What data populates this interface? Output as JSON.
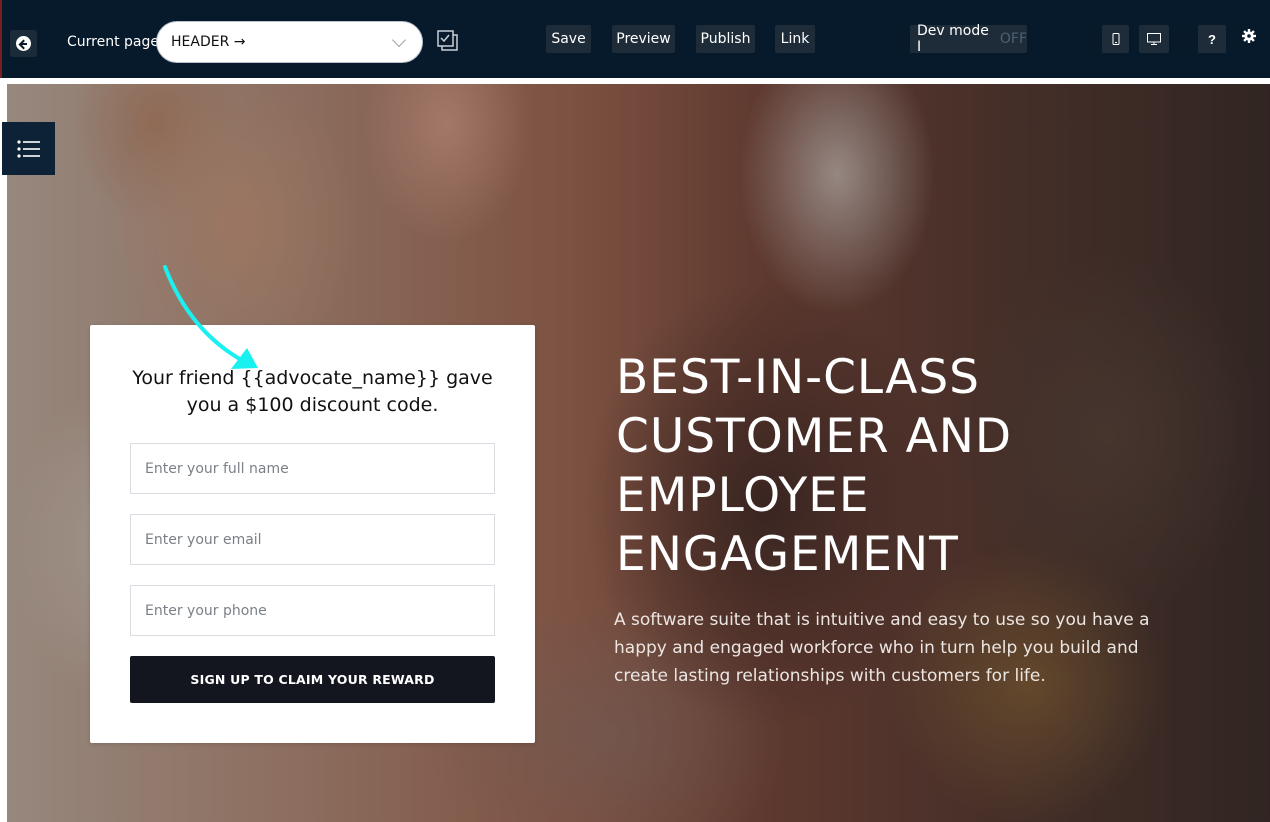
{
  "toolbar": {
    "current_page_label": "Current page",
    "current_page_value": "HEADER →",
    "save_label": "Save",
    "preview_label": "Preview",
    "publish_label": "Publish",
    "link_label": "Link",
    "dev_mode_label": "Dev mode I",
    "dev_mode_state": "OFF",
    "help_label": "?",
    "icons": {
      "back": "back-arrow-icon",
      "pages": "pages-checklist-icon",
      "mobile": "mobile-icon",
      "desktop": "desktop-icon",
      "settings": "gear-icon",
      "sidebar": "list-icon"
    }
  },
  "form": {
    "title": "Your friend {{advocate_name}} gave you a $100  discount code.",
    "name_placeholder": "Enter your full name",
    "email_placeholder": "Enter your email",
    "phone_placeholder": "Enter your phone",
    "submit_label": "SIGN UP TO CLAIM  YOUR REWARD"
  },
  "hero": {
    "headline_line1": "BEST-IN-CLASS",
    "headline_line2": "CUSTOMER AND",
    "headline_line3": "EMPLOYEE",
    "headline_line4": "ENGAGEMENT",
    "subtext": "A software suite that is intuitive and easy to use so you have a happy and engaged workforce who in turn help you build and create lasting relationships with customers for life."
  },
  "colors": {
    "toolbar_bg": "#061a2b",
    "button_bg": "#1e2c3a",
    "submit_bg": "#14161f",
    "annotation_arrow": "#19f0f0"
  }
}
